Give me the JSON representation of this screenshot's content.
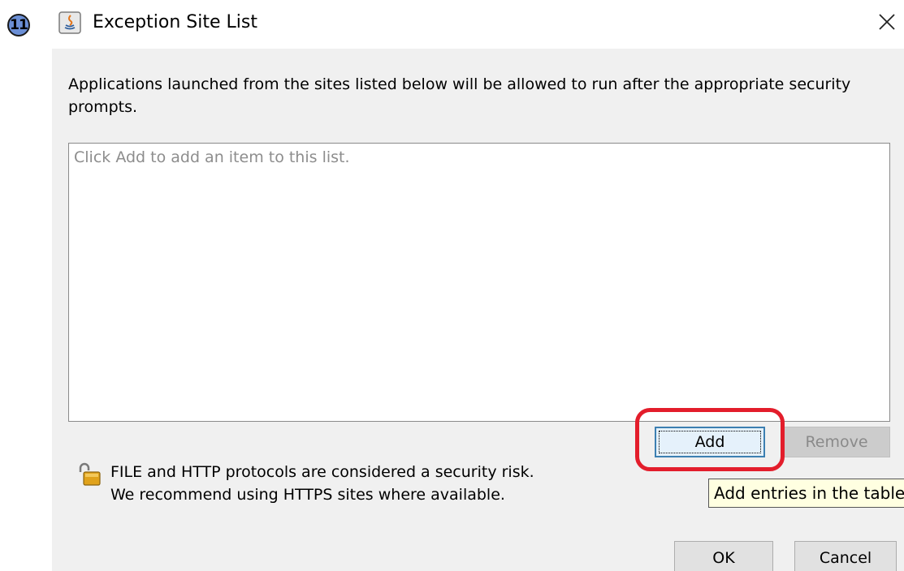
{
  "step": {
    "number": "11"
  },
  "window": {
    "title": "Exception Site List",
    "icon": "java-icon",
    "close_icon": "close-icon"
  },
  "description": "Applications launched from the sites listed below will be allowed to run after the appropriate security prompts.",
  "site_list": {
    "placeholder": "Click Add to add an item to this list.",
    "items": []
  },
  "buttons": {
    "add": "Add",
    "remove": "Remove",
    "ok": "OK",
    "cancel": "Cancel"
  },
  "warning": {
    "icon": "unlocked-padlock-icon",
    "line1": "FILE and HTTP protocols are considered a security risk.",
    "line2": "We recommend using HTTPS sites where available."
  },
  "tooltip": "Add entries in the table",
  "colors": {
    "highlight": "#e31d2b",
    "dialog_bg": "#f0f0f0",
    "tooltip_bg": "#ffffe1",
    "focus_border": "#3c7fb1"
  }
}
